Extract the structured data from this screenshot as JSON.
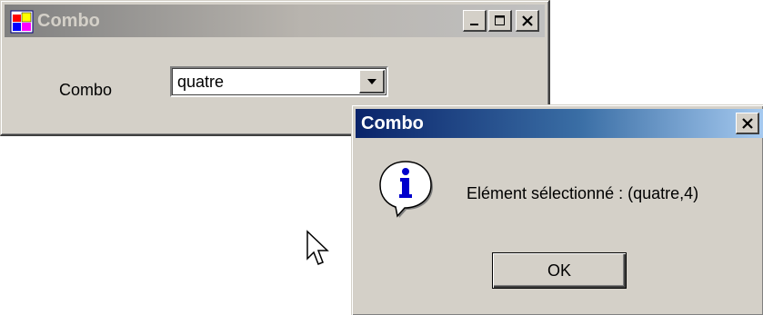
{
  "main_window": {
    "title": "Combo",
    "combo_label": "Combo",
    "combo_value": "quatre",
    "icons": {
      "app": "app-icon",
      "minimize": "minimize-icon",
      "maximize": "maximize-icon",
      "close": "close-icon",
      "dropdown": "chevron-down-icon"
    }
  },
  "dialog": {
    "title": "Combo",
    "message": "Elément sélectionné : (quatre,4)",
    "ok_label": "OK",
    "icons": {
      "info": "info-icon",
      "close": "close-icon"
    }
  },
  "colors": {
    "window_face": "#d4d0c8",
    "inactive_title_start": "#808080",
    "active_title_start": "#0a246a",
    "active_title_end": "#a6caf0"
  }
}
